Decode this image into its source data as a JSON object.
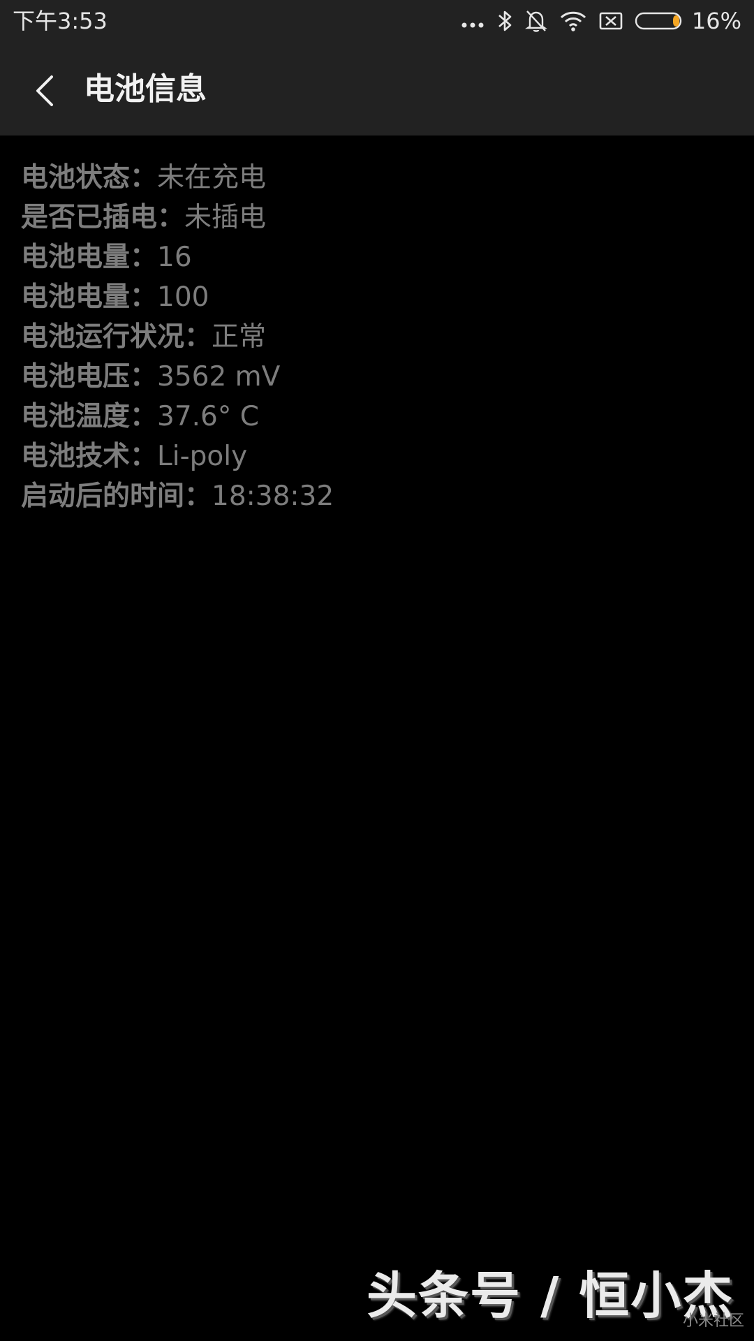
{
  "status_bar": {
    "time": "下午3:53",
    "battery_percent": "16%",
    "battery_level": 0.16,
    "battery_accent": "#f5a623",
    "icons": [
      "more-dots-icon",
      "bluetooth-icon",
      "mute-bell-icon",
      "wifi-icon",
      "no-sim-icon",
      "battery-icon"
    ]
  },
  "header": {
    "back_icon": "chevron-left-icon",
    "title": "电池信息"
  },
  "info": [
    {
      "label": "电池状态：",
      "value": "未在充电"
    },
    {
      "label": "是否已插电：",
      "value": "未插电"
    },
    {
      "label": "电池电量：",
      "value": "16"
    },
    {
      "label": "电池电量：",
      "value": "100"
    },
    {
      "label": "电池运行状况：",
      "value": "正常"
    },
    {
      "label": "电池电压：",
      "value": "3562 mV"
    },
    {
      "label": "电池温度：",
      "value": "37.6° C"
    },
    {
      "label": "电池技术：",
      "value": "Li-poly"
    },
    {
      "label": "启动后的时间：",
      "value": "18:38:32"
    }
  ],
  "watermark": {
    "text": "头条号 / 恒小杰",
    "community": "小米社区"
  }
}
